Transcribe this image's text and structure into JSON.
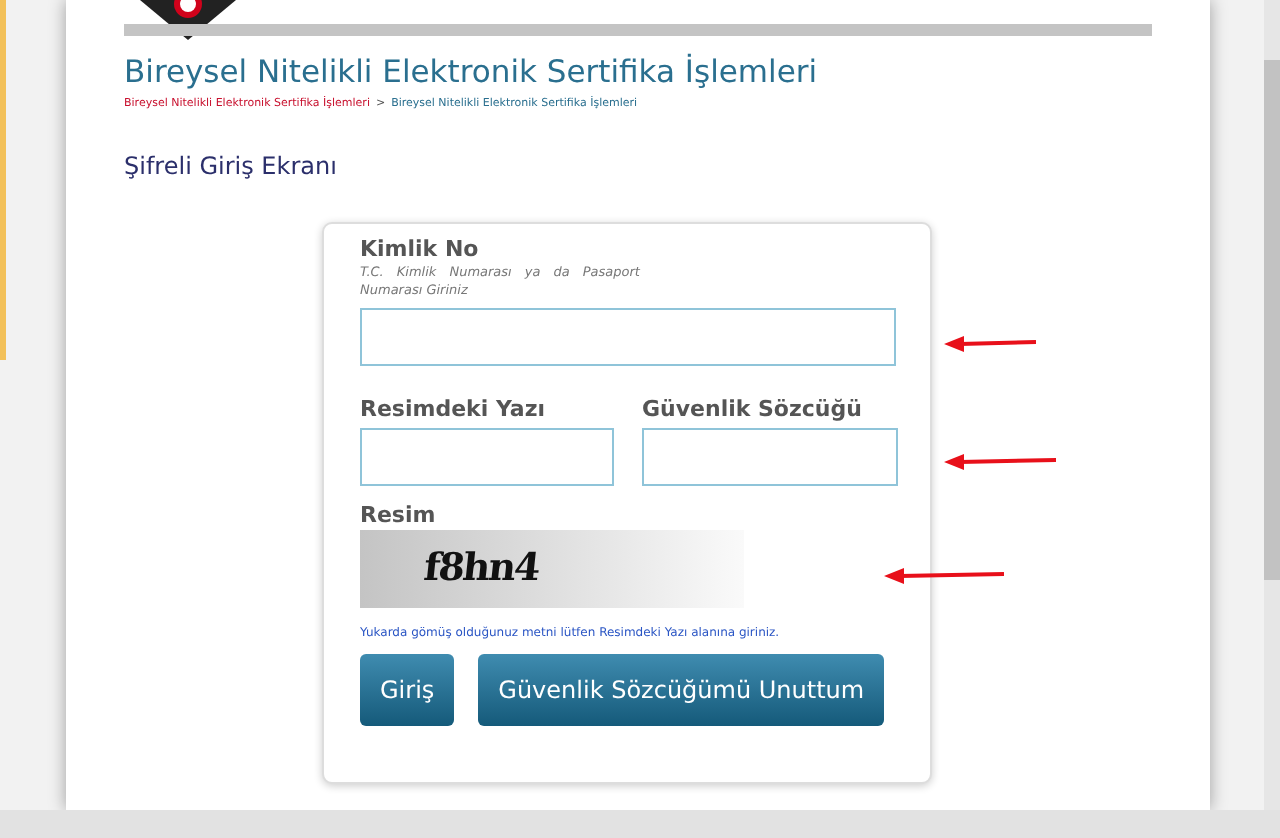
{
  "page_title": "Bireysel Nitelikli Elektronik Sertifika İşlemleri",
  "breadcrumb": [
    {
      "label": "Bireysel Nitelikli Elektronik Sertifika İşlemleri",
      "kind": "link"
    },
    {
      "label": ">",
      "kind": "separator"
    },
    {
      "label": "Bireysel Nitelikli Elektronik Sertifika İşlemleri",
      "kind": "current"
    }
  ],
  "section_title": "Şifreli Giriş Ekranı",
  "form": {
    "id_field": {
      "label": "Kimlik No",
      "hint": "T.C. Kimlik Numarası ya da Pasaport Numarası Giriniz"
    },
    "captcha_field": {
      "label": "Resimdeki Yazı"
    },
    "password_field": {
      "label": "Güvenlik Sözcüğü"
    },
    "image_label": "Resim",
    "captcha_text": "f8hn4",
    "help": "Yukarda gömüş olduğunuz metni lütfen Resimdeki Yazı alanına giriniz.",
    "buttons": [
      "Giriş",
      "Güvenlik Sözcüğümü Unuttum"
    ]
  }
}
